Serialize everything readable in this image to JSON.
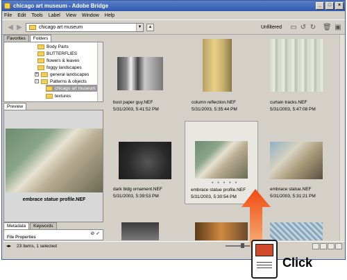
{
  "window": {
    "title": "chicago art museum - Adobe Bridge",
    "controls": [
      "_",
      "□",
      "×"
    ]
  },
  "menu": [
    "File",
    "Edit",
    "Tools",
    "Label",
    "View",
    "Window",
    "Help"
  ],
  "toolbar": {
    "path": "chicago art museum",
    "filter_label": "Unfiltered"
  },
  "left_tabs": {
    "favorites": "Favorites",
    "folders": "Folders"
  },
  "folder_tree": [
    {
      "label": "Body Parts"
    },
    {
      "label": "BUTTERFLIES"
    },
    {
      "label": "flowers & leaves"
    },
    {
      "label": "foggy landscapes"
    },
    {
      "label": "general landscapes"
    },
    {
      "label": "Patterns & objects"
    },
    {
      "label": "chicago art museum"
    },
    {
      "label": "textures"
    }
  ],
  "preview": {
    "tab": "Preview",
    "caption": "embrace statue profile.NEF"
  },
  "metadata": {
    "tab_metadata": "Metadata",
    "tab_keywords": "Keywords",
    "row": "File Properties"
  },
  "thumbnails": [
    {
      "name": "bust paper guy.NEF",
      "date": "5/31/2003, 5:41:52 PM"
    },
    {
      "name": "column reflection.NEF",
      "date": "5/31/2003, 5:35:44 PM"
    },
    {
      "name": "curtain tracks.NEF",
      "date": "5/31/2003, 5:47:08 PM"
    },
    {
      "name": "dark bldg ornament.NEF",
      "date": "5/31/2003, 5:39:53 PM"
    },
    {
      "name": "embrace statue profile.NEF",
      "date": "5/31/2003, 5:30:54 PM",
      "dots": "• • • • •"
    },
    {
      "name": "embrace statue.NEF",
      "date": "5/31/2003, 5:31:21 PM"
    }
  ],
  "status": {
    "text": "23 items, 1 selected"
  },
  "callout": {
    "label": "Click"
  }
}
